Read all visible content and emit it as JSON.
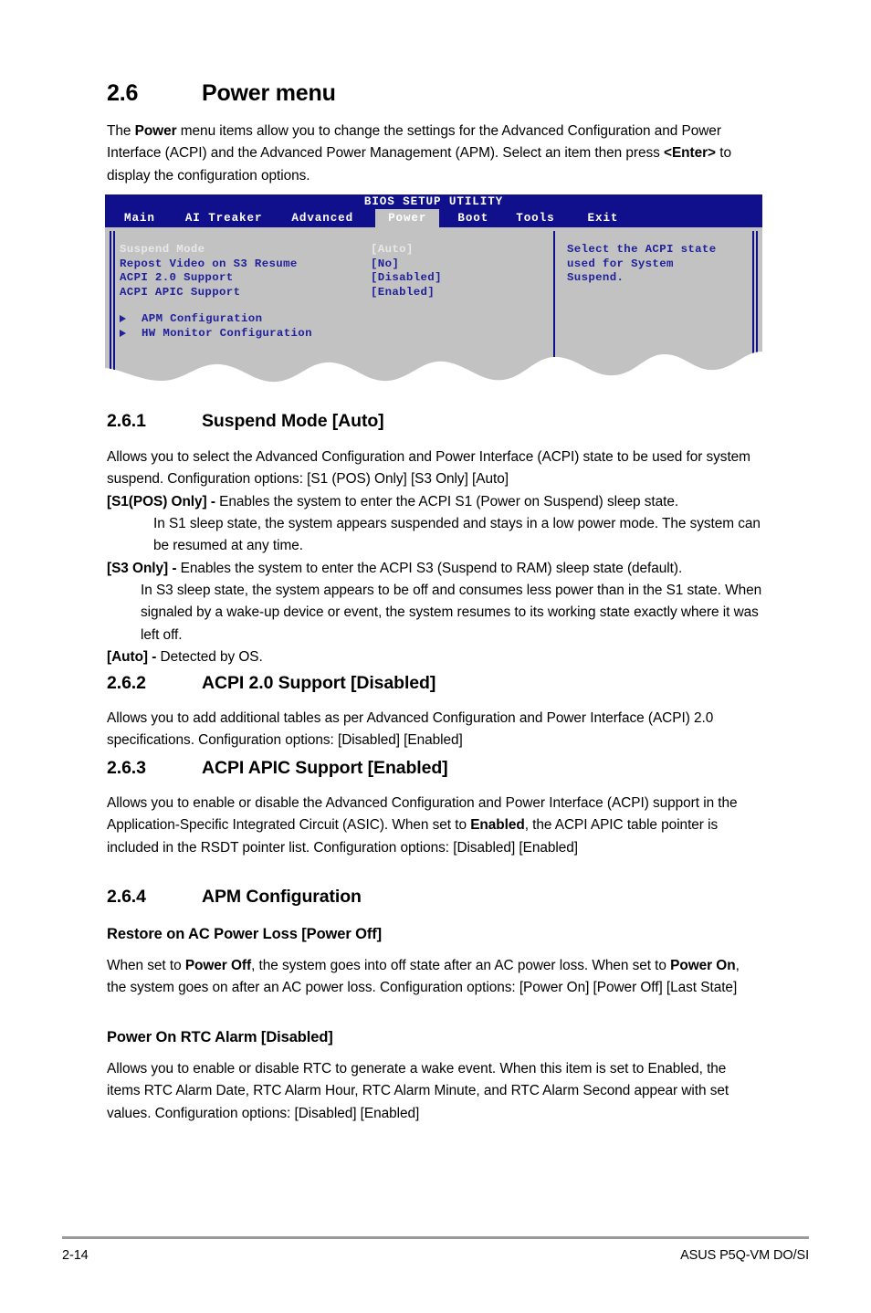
{
  "section": {
    "number": "2.6",
    "title": "Power menu",
    "intro_html": "The <b>Power</b> menu items allow you to change the settings for the Advanced Configuration and Power Interface (ACPI) and the Advanced Power Management (APM). Select an item then press <b>&lt;Enter&gt;</b> to display the configuration options."
  },
  "bios": {
    "title": "BIOS SETUP UTILITY",
    "menu": [
      {
        "label": "Main",
        "active": false
      },
      {
        "label": "AI Treaker",
        "active": false
      },
      {
        "label": "Advanced",
        "active": false
      },
      {
        "label": "Power",
        "active": true
      },
      {
        "label": "Boot",
        "active": false
      },
      {
        "label": "Tools",
        "active": false
      },
      {
        "label": "Exit",
        "active": false
      }
    ],
    "items": [
      {
        "label": "Suspend Mode",
        "value": "[Auto]",
        "selected": true
      },
      {
        "label": "Repost Video on S3 Resume",
        "value": "[No]",
        "selected": false
      },
      {
        "label": "ACPI 2.0 Support",
        "value": "[Disabled]",
        "selected": false
      },
      {
        "label": "ACPI APIC Support",
        "value": "[Enabled]",
        "selected": false
      }
    ],
    "submenus": [
      {
        "label": "APM Configuration"
      },
      {
        "label": "HW Monitor Configuration"
      }
    ],
    "help_text": "Select the ACPI state\nused for System\nSuspend.",
    "colors": {
      "title_bar": "#10108c",
      "panel": "#c2c2c2",
      "text": "#20209a",
      "selected_text": "#e8e8e8",
      "active_tab_bg": "#c2c2c2"
    }
  },
  "subsections": {
    "s261": {
      "number": "2.6.1",
      "title": "Suspend Mode [Auto]",
      "body_html": "Allows you to select the Advanced Configuration and Power Interface (ACPI) state to be used for system suspend. Configuration options: [S1 (POS) Only] [S3 Only] [Auto]",
      "opt1_html": "<b>[S1(POS) Only] -</b> Enables the system to enter the ACPI S1 (Power on Suspend) sleep state.",
      "opt1_cont_html": "In S1 sleep state, the system appears suspended and stays in a low power mode. The system can be resumed at any time.",
      "opt2_html": "<b>[S3 Only] -</b> Enables the system to enter the ACPI S3 (Suspend to RAM) sleep state (default).",
      "opt2_cont_html": "In S3 sleep state, the system appears to be off and consumes less power than in the S1 state. When signaled by a wake-up device or event, the system resumes to its working state exactly where it was left off.",
      "opt3_html": "<b>[Auto] -</b> Detected by OS."
    },
    "s262": {
      "number": "2.6.2",
      "title": "ACPI 2.0 Support [Disabled]",
      "body_html": "Allows you to add additional tables as per Advanced Configuration and Power Interface (ACPI) 2.0 specifications. Configuration options: [Disabled] [Enabled]"
    },
    "s263": {
      "number": "2.6.3",
      "title": "ACPI APIC Support [Enabled]",
      "body_html": "Allows you to enable or disable the Advanced Configuration and Power Interface (ACPI) support in the Application-Specific Integrated Circuit (ASIC). When set to <b>Enabled</b>, the ACPI APIC table pointer is included in the RSDT pointer list. Configuration options: [Disabled] [Enabled]"
    },
    "s264": {
      "number": "2.6.4",
      "title": "APM Configuration",
      "item1": {
        "title": "Restore on AC Power Loss [Power Off]",
        "body_html": "When set to <b>Power Off</b>, the system goes into off state after an AC power loss. When set to <b>Power On</b>, the system goes on after an AC power loss. Configuration options: [Power On] [Power Off] [Last State]"
      },
      "item2": {
        "title": "Power On RTC Alarm [Disabled]",
        "body_html": "Allows you to enable or disable RTC to generate a wake event. When this item is set to Enabled, the items RTC Alarm Date, RTC Alarm Hour, RTC Alarm Minute, and RTC Alarm Second appear with set values. Configuration options: [Disabled] [Enabled]"
      }
    }
  },
  "footer": {
    "page_number": "2-14",
    "product": "ASUS P5Q-VM DO/SI"
  }
}
